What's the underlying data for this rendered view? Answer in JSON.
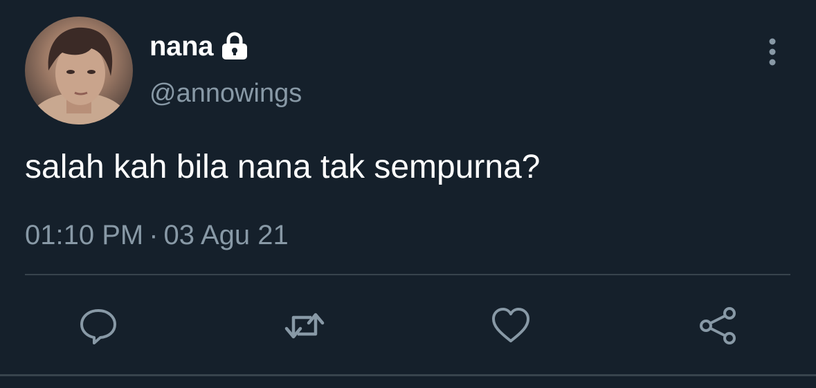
{
  "tweet": {
    "author": {
      "display_name": "nana",
      "handle": "@annowings",
      "protected": true,
      "avatar_icon": "profile-photo"
    },
    "text": "salah kah bila nana tak sempurna?",
    "time": "01:10 PM",
    "separator": "·",
    "date": "03 Agu 21"
  },
  "actions": [
    {
      "name": "reply",
      "icon": "speech-bubble-icon"
    },
    {
      "name": "retweet",
      "icon": "retweet-arrows-icon"
    },
    {
      "name": "like",
      "icon": "heart-icon"
    },
    {
      "name": "share",
      "icon": "share-nodes-icon"
    }
  ],
  "menu": {
    "icon": "vertical-ellipsis-icon"
  },
  "colors": {
    "background": "#15202b",
    "text_primary": "#ffffff",
    "text_secondary": "#8899a6",
    "divider": "#38444d"
  }
}
